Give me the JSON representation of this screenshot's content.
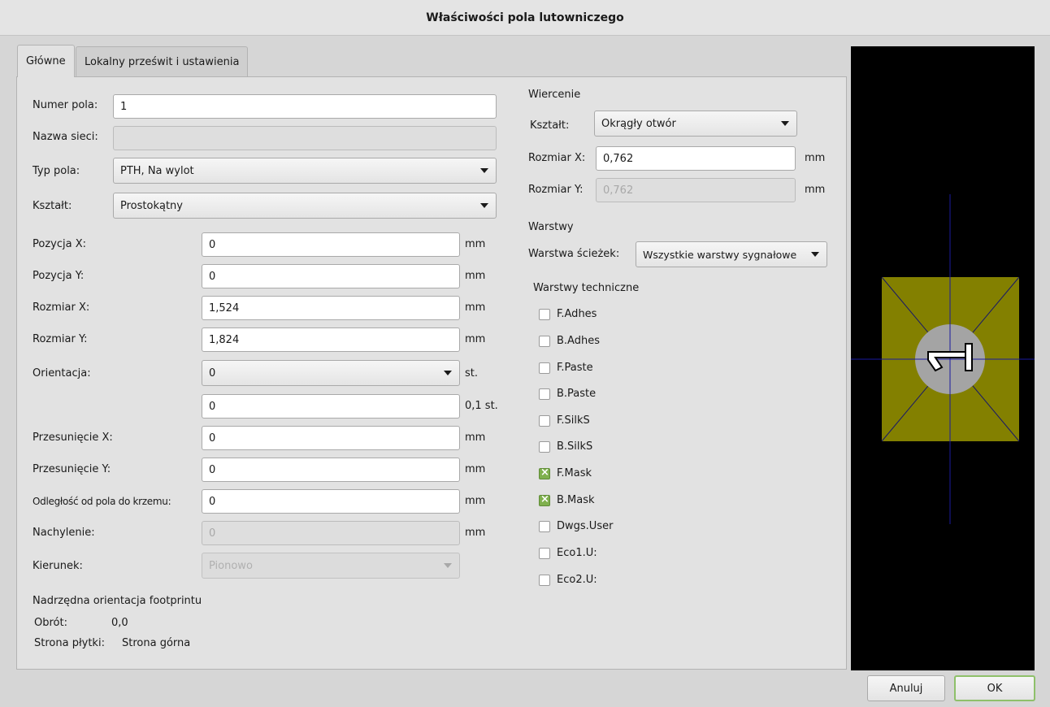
{
  "window": {
    "title": "Właściwości pola lutowniczego"
  },
  "tabs": [
    {
      "label": "Główne",
      "active": true
    },
    {
      "label": "Lokalny prześwit i ustawienia",
      "active": false
    }
  ],
  "general": {
    "pad_number": {
      "label": "Numer pola:",
      "value": "1"
    },
    "net_name": {
      "label": "Nazwa sieci:",
      "value": ""
    },
    "pad_type": {
      "label": "Typ pola:",
      "value": "PTH, Na wylot"
    },
    "shape": {
      "label": "Kształt:",
      "value": "Prostokątny"
    },
    "pos_x": {
      "label": "Pozycja X:",
      "value": "0",
      "unit": "mm"
    },
    "pos_y": {
      "label": "Pozycja Y:",
      "value": "0",
      "unit": "mm"
    },
    "size_x": {
      "label": "Rozmiar X:",
      "value": "1,524",
      "unit": "mm"
    },
    "size_y": {
      "label": "Rozmiar Y:",
      "value": "1,824",
      "unit": "mm"
    },
    "orientation": {
      "label": "Orientacja:",
      "value": "0",
      "unit": "st."
    },
    "orientation_fine": {
      "value": "0",
      "unit": "0,1 st."
    },
    "offset_x": {
      "label": "Przesunięcie X:",
      "value": "0",
      "unit": "mm"
    },
    "offset_y": {
      "label": "Przesunięcie Y:",
      "value": "0",
      "unit": "mm"
    },
    "pad_to_die": {
      "label": "Odległość od pola do krzemu:",
      "value": "0",
      "unit": "mm"
    },
    "trapezoid": {
      "label": "Nachylenie:",
      "value": "0",
      "unit": "mm"
    },
    "direction": {
      "label": "Kierunek:",
      "value": "Pionowo"
    },
    "parent": {
      "heading": "Nadrzędna orientacja footprintu",
      "rotation_label": "Obrót:",
      "rotation_value": "0,0",
      "side_label": "Strona płytki:",
      "side_value": "Strona górna"
    }
  },
  "drill": {
    "heading": "Wiercenie",
    "shape": {
      "label": "Kształt:",
      "value": "Okrągły otwór"
    },
    "size_x": {
      "label": "Rozmiar X:",
      "value": "0,762",
      "unit": "mm"
    },
    "size_y": {
      "label": "Rozmiar Y:",
      "value": "0,762",
      "unit": "mm"
    }
  },
  "layers": {
    "heading": "Warstwy",
    "copper_label": "Warstwa ścieżek:",
    "copper_value": "Wszystkie warstwy sygnałowe",
    "tech_heading": "Warstwy techniczne",
    "tech": [
      {
        "name": "F.Adhes",
        "checked": false
      },
      {
        "name": "B.Adhes",
        "checked": false
      },
      {
        "name": "F.Paste",
        "checked": false
      },
      {
        "name": "B.Paste",
        "checked": false
      },
      {
        "name": "F.SilkS",
        "checked": false
      },
      {
        "name": "B.SilkS",
        "checked": false
      },
      {
        "name": "F.Mask",
        "checked": true
      },
      {
        "name": "B.Mask",
        "checked": true
      },
      {
        "name": "Dwgs.User",
        "checked": false
      },
      {
        "name": "Eco1.U:",
        "checked": false
      },
      {
        "name": "Eco2.U:",
        "checked": false
      }
    ]
  },
  "preview": {
    "colors": {
      "background": "#000000",
      "pad": "#838000",
      "hole": "#a4a4a4",
      "crosshair": "#1a1aa0",
      "diagonals": "#16166a"
    }
  },
  "buttons": {
    "cancel": "Anuluj",
    "ok": "OK"
  }
}
